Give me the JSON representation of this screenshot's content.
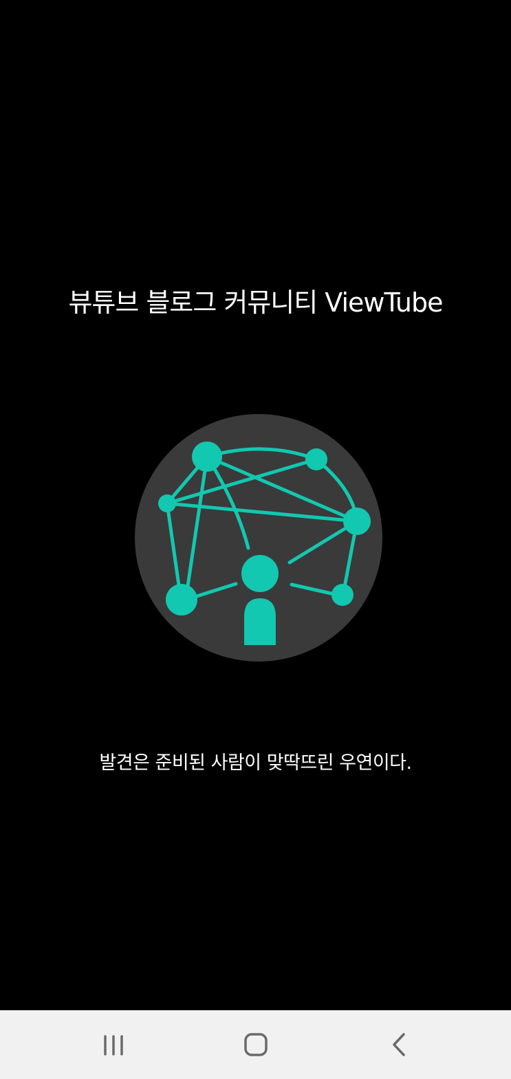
{
  "splash": {
    "title": "뷰튜브 블로그 커뮤니티 ViewTube",
    "tagline": "발견은 준비된 사람이 맞딱뜨린 우연이다."
  },
  "logo": {
    "icon": "network-person-logo-icon",
    "circle_color": "#3a3a3a",
    "accent_color": "#12c8b0"
  },
  "navigation_bar": {
    "background": "#f1f1f1",
    "buttons": [
      {
        "name": "recent-apps",
        "icon": "recents-icon"
      },
      {
        "name": "home",
        "icon": "home-icon"
      },
      {
        "name": "back",
        "icon": "back-icon"
      }
    ]
  }
}
